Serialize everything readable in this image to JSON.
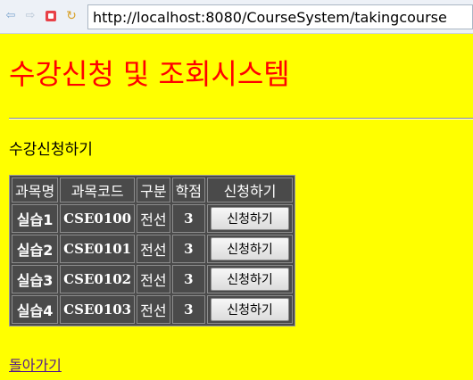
{
  "browser": {
    "url": "http://localhost:8080/CourseSystem/takingcourse",
    "icons": [
      "back-arrow-icon",
      "forward-arrow-icon",
      "stop-icon",
      "refresh-icon"
    ]
  },
  "page": {
    "title": "수강신청 및 조회시스템",
    "section_label": "수강신청하기",
    "back_link": "돌아가기",
    "colors": {
      "background": "#ffff00",
      "title": "#ff0000",
      "table_bg": "#4a4a4a"
    }
  },
  "table": {
    "headers": [
      "과목명",
      "과목코드",
      "구분",
      "학점",
      "신청하기"
    ],
    "rows": [
      {
        "name": "실습1",
        "code": "CSE0100",
        "type": "전선",
        "credits": "3",
        "button": "신청하기"
      },
      {
        "name": "실습2",
        "code": "CSE0101",
        "type": "전선",
        "credits": "3",
        "button": "신청하기"
      },
      {
        "name": "실습3",
        "code": "CSE0102",
        "type": "전선",
        "credits": "3",
        "button": "신청하기"
      },
      {
        "name": "실습4",
        "code": "CSE0103",
        "type": "전선",
        "credits": "3",
        "button": "신청하기"
      }
    ]
  }
}
